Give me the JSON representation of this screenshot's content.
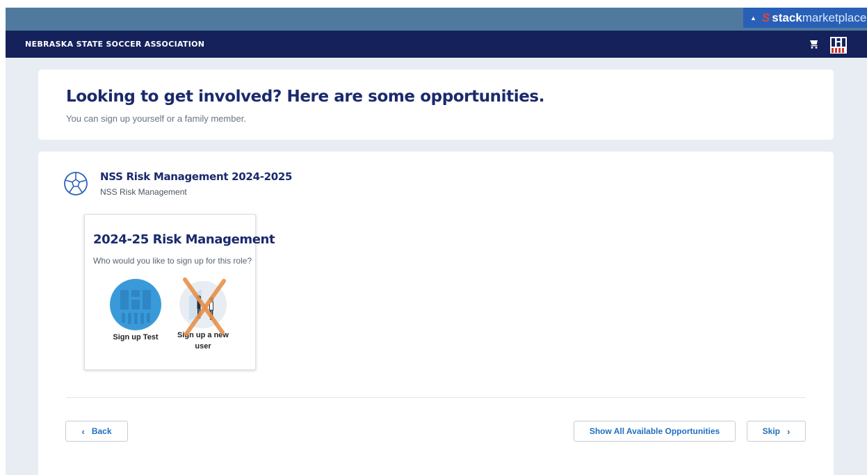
{
  "marketplace": {
    "brand_bold": "stack",
    "brand_light": "marketplace"
  },
  "header": {
    "org_name": "NEBRASKA STATE SOCCER ASSOCIATION"
  },
  "intro": {
    "title": "Looking to get involved? Here are some opportunities.",
    "subtitle": "You can sign up yourself or a family member."
  },
  "opportunity": {
    "title": "NSS Risk Management 2024-2025",
    "subtitle": "NSS Risk Management",
    "role": {
      "title": "2024-25 Risk Management",
      "question": "Who would you like to sign up for this role?",
      "choices": [
        {
          "label": "Sign up Test"
        },
        {
          "label": "Sign up a new user"
        }
      ]
    }
  },
  "buttons": {
    "back": "Back",
    "show_all": "Show All Available Opportunities",
    "skip": "Skip"
  },
  "icons": {
    "marketplace": "triangle-icon",
    "cart": "cart-icon",
    "logo": "nsa-logo-icon",
    "opportunity": "soccer-ball-icon",
    "chevron_left": "chevron-left-icon",
    "chevron_right": "chevron-right-icon"
  },
  "colors": {
    "navy": "#14215a",
    "title": "#1a2a6c",
    "link": "#1f6fc0",
    "page_bg": "#e8edf3",
    "avatar": "#3a9ad9",
    "cross": "#e8914a"
  }
}
